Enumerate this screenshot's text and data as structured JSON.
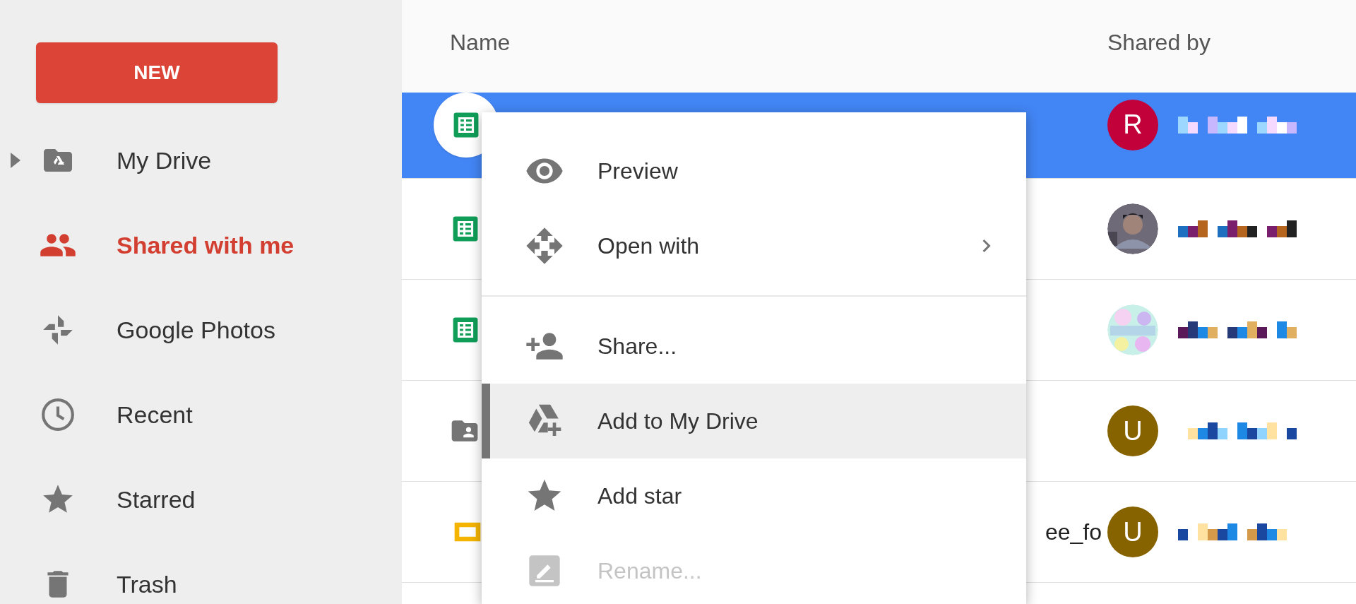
{
  "sidebar": {
    "new_button": "NEW",
    "items": [
      {
        "label": "My Drive",
        "kind": "drive",
        "selected": false,
        "expandable": true
      },
      {
        "label": "Shared with me",
        "kind": "people",
        "selected": true,
        "expandable": false
      },
      {
        "label": "Google Photos",
        "kind": "photos",
        "selected": false,
        "expandable": false
      },
      {
        "label": "Recent",
        "kind": "clock",
        "selected": false,
        "expandable": false
      },
      {
        "label": "Starred",
        "kind": "star",
        "selected": false,
        "expandable": false
      },
      {
        "label": "Trash",
        "kind": "trash",
        "selected": false,
        "expandable": false
      }
    ]
  },
  "table": {
    "columns": [
      "Name",
      "Shared by"
    ],
    "rows": [
      {
        "kind": "sheet",
        "selected": true,
        "shared_by": {
          "kind": "letter",
          "letter": "R",
          "color": "#c2003a"
        }
      },
      {
        "kind": "sheet",
        "selected": false
      },
      {
        "kind": "sheet",
        "selected": false
      },
      {
        "kind": "shared-folder",
        "selected": false,
        "shared_by": {
          "kind": "letter",
          "letter": "U",
          "color": "#876300"
        }
      },
      {
        "kind": "slides",
        "selected": false,
        "name": "ee_fo",
        "shared_by": {
          "kind": "letter",
          "letter": "U",
          "color": "#876300"
        }
      }
    ]
  },
  "context_menu": {
    "items": [
      {
        "kind": "preview",
        "label": "Preview",
        "highlighted": false,
        "disabled": false,
        "submenu": false
      },
      {
        "kind": "open-with",
        "label": "Open with",
        "highlighted": false,
        "disabled": false,
        "submenu": true
      },
      {
        "kind": "divider"
      },
      {
        "kind": "share",
        "label": "Share...",
        "highlighted": false,
        "disabled": false,
        "submenu": false
      },
      {
        "kind": "add-to-drive",
        "label": "Add to My Drive",
        "highlighted": true,
        "disabled": false,
        "submenu": false
      },
      {
        "kind": "star",
        "label": "Add star",
        "highlighted": false,
        "disabled": false,
        "submenu": false
      },
      {
        "kind": "rename",
        "label": "Rename...",
        "highlighted": false,
        "disabled": true,
        "submenu": false
      }
    ]
  }
}
